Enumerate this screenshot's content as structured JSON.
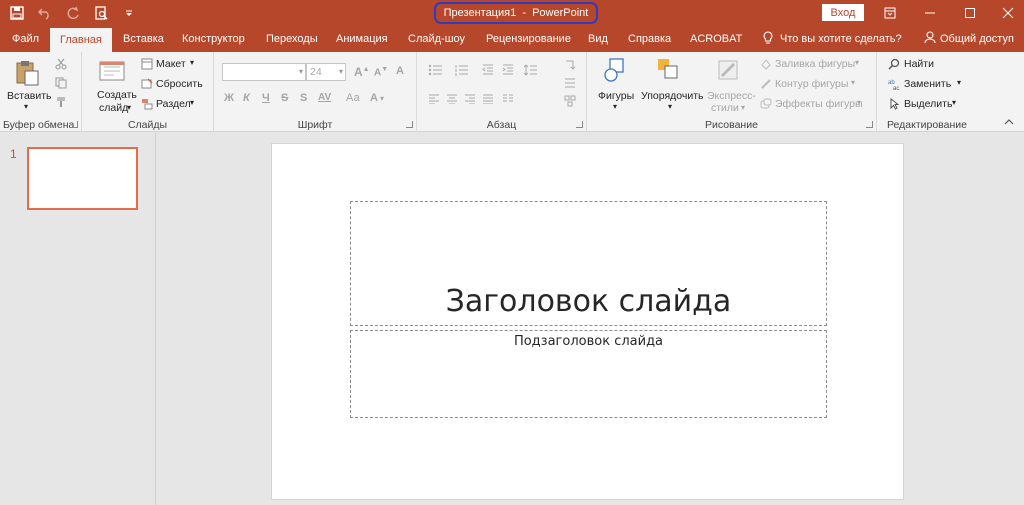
{
  "titlebar": {
    "document_title": "Презентация1  -  PowerPoint",
    "signin_label": "Вход",
    "qat": [
      "save-icon",
      "undo-icon",
      "redo-icon",
      "print-preview-icon",
      "customize-qat-icon"
    ],
    "window_controls": [
      "ribbon-display-icon",
      "minimize-icon",
      "restore-icon",
      "close-icon"
    ]
  },
  "tabs": {
    "items": [
      "Файл",
      "Главная",
      "Вставка",
      "Конструктор",
      "Переходы",
      "Анимация",
      "Слайд-шоу",
      "Рецензирование",
      "Вид",
      "Справка",
      "ACROBAT"
    ],
    "active": "Главная",
    "tell_me": "Что вы хотите сделать?",
    "share": "Общий доступ"
  },
  "ribbon": {
    "clipboard": {
      "label": "Буфер обмена",
      "paste": "Вставить"
    },
    "slides": {
      "label": "Слайды",
      "new_slide_1": "Создать",
      "new_slide_2": "слайд",
      "layout": "Макет",
      "reset": "Сбросить",
      "section": "Раздел"
    },
    "font": {
      "label": "Шрифт",
      "font_name": "",
      "font_size": "24",
      "bold": "Ж",
      "italic": "К",
      "underline": "Ч",
      "strike": "S",
      "spacing": "AV",
      "case": "Аа",
      "color": "А"
    },
    "paragraph": {
      "label": "Абзац"
    },
    "drawing": {
      "label": "Рисование",
      "shapes": "Фигуры",
      "arrange": "Упорядочить",
      "quick_styles_1": "Экспресс-",
      "quick_styles_2": "стили",
      "fill": "Заливка фигуры",
      "outline": "Контур фигуры",
      "effects": "Эффекты фигуры"
    },
    "editing": {
      "label": "Редактирование",
      "find": "Найти",
      "replace": "Заменить",
      "select": "Выделить"
    }
  },
  "thumbnails": {
    "slide_number": "1"
  },
  "slide": {
    "title_placeholder": "Заголовок слайда",
    "subtitle_placeholder": "Подзаголовок слайда"
  },
  "colors": {
    "accent": "#b7472a",
    "highlight": "#2e3bc2",
    "thumb_border": "#e46c4a"
  }
}
